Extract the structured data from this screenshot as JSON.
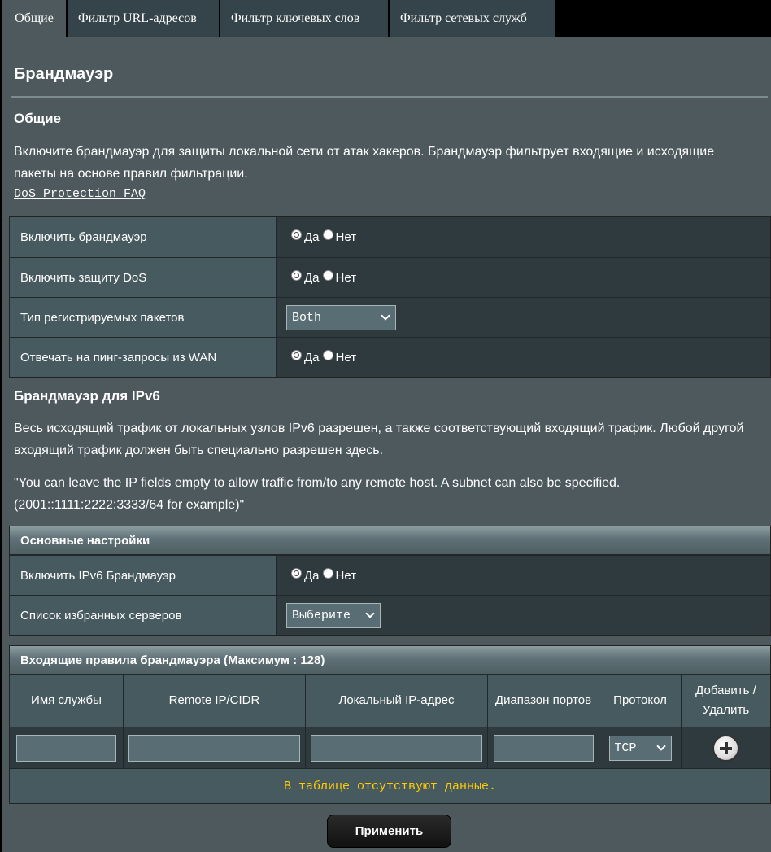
{
  "tabs": [
    "Общие",
    "Фильтр URL-адресов",
    "Фильтр ключевых слов",
    "Фильтр сетевых служб"
  ],
  "page_title": "Брандмауэр",
  "general": {
    "heading": "Общие",
    "description": "Включите брандмауэр для защиты локальной сети от атак хакеров. Брандмауэр фильтрует входящие и исходящие пакеты на основе правил фильтрации.",
    "faq_link": "DoS Protection FAQ",
    "rows": [
      {
        "label": "Включить брандмауэр",
        "yes": "Да",
        "no": "Нет"
      },
      {
        "label": "Включить защиту DoS",
        "yes": "Да",
        "no": "Нет"
      },
      {
        "label": "Тип регистрируемых пакетов",
        "select": "Both"
      },
      {
        "label": "Отвечать на пинг-запросы из WAN",
        "yes": "Да",
        "no": "Нет"
      }
    ]
  },
  "ipv6": {
    "heading": "Брандмауэр для IPv6",
    "description": "Весь исходящий трафик от локальных узлов IPv6 разрешен, а также соответствующий входящий трафик. Любой другой входящий трафик должен быть специально разрешен здесь.",
    "note": "\"You can leave the IP fields empty to allow traffic from/to any remote host. A subnet can also be specified. (2001::1111:2222:3333/64 for example)\"",
    "basic_header": "Основные настройки",
    "enable_label": "Включить IPv6 Брандмауэр",
    "yes": "Да",
    "no": "Нет",
    "servers_label": "Список избранных серверов",
    "servers_select": "Выберите"
  },
  "rules": {
    "header": "Входящие правила брандмауэра (Максимум : 128)",
    "columns": [
      "Имя службы",
      "Remote IP/CIDR",
      "Локальный IP-адрес",
      "Диапазон портов",
      "Протокол",
      "Добавить / Удалить"
    ],
    "protocol": "TCP",
    "empty_message": "В таблице отсутствуют данные."
  },
  "apply_label": "Применить"
}
